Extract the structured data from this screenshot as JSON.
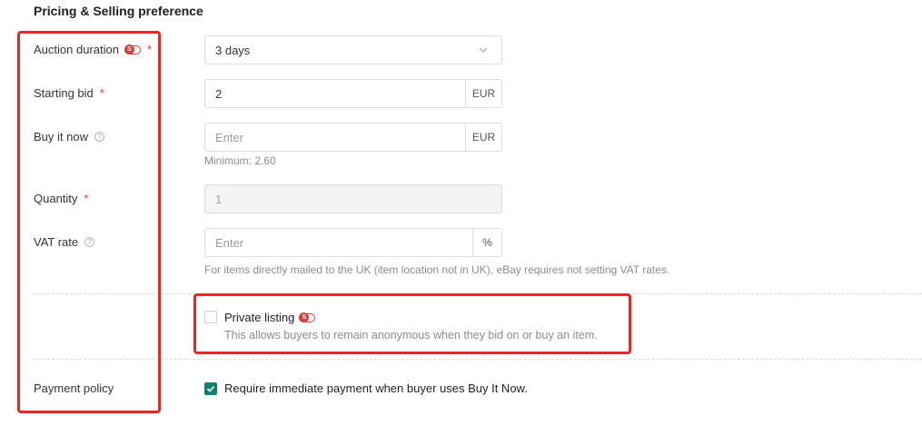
{
  "section": {
    "title": "Pricing & Selling preference"
  },
  "auction_duration": {
    "label": "Auction duration",
    "required": "*",
    "value": "3 days",
    "badge": "S"
  },
  "starting_bid": {
    "label": "Starting bid",
    "required": "*",
    "value": "2",
    "currency": "EUR"
  },
  "buy_it_now": {
    "label": "Buy it now",
    "help": "?",
    "placeholder": "Enter",
    "currency": "EUR",
    "hint": "Minimum: 2.60"
  },
  "quantity": {
    "label": "Quantity",
    "required": "*",
    "value": "1"
  },
  "vat_rate": {
    "label": "VAT rate",
    "help": "?",
    "placeholder": "Enter",
    "unit": "%",
    "hint": "For items directly mailed to the UK (item location not in UK), eBay requires not setting VAT rates."
  },
  "private_listing": {
    "label": "Private listing",
    "badge": "S",
    "description": "This allows buyers to remain anonymous when they bid on or buy an item.",
    "checked": false
  },
  "payment_policy": {
    "label": "Payment policy",
    "option_label": "Require immediate payment when buyer uses Buy It Now.",
    "checked": true
  },
  "colors": {
    "accent": "#11806f",
    "highlight": "#ec2525",
    "required": "#e23b3b"
  }
}
